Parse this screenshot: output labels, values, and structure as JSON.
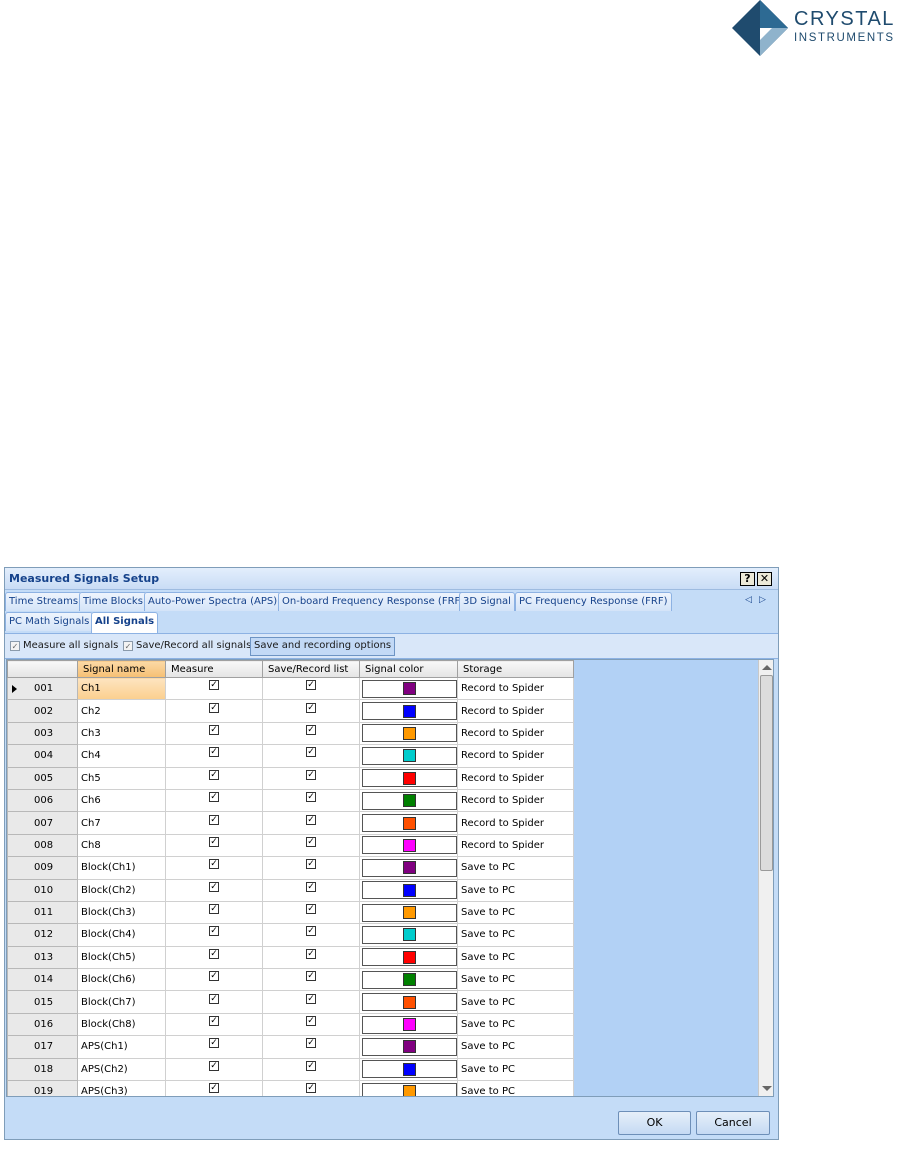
{
  "logo": {
    "word1": "CRYSTAL",
    "word2": "INSTRUMENTS"
  },
  "dialog": {
    "title": "Measured Signals Setup",
    "help_label": "?",
    "close_label": "✕",
    "tabs_row1": [
      "Time Streams",
      "Time Blocks",
      "Auto-Power Spectra (APS)",
      "On-board Frequency Response (FRF)",
      "3D Signal",
      "PC Frequency Response (FRF)"
    ],
    "tabs_row2": [
      "PC Math Signals",
      "All Signals"
    ],
    "tab_scroll_left": "◁",
    "tab_scroll_right": "▷",
    "toolbar": {
      "measure_all": "Measure all signals",
      "save_record_all": "Save/Record all signals",
      "options_button": "Save and recording options"
    },
    "columns": [
      "Signal name",
      "Measure",
      "Save/Record list",
      "Signal color",
      "Storage"
    ],
    "rows": [
      {
        "id": "001",
        "name": "Ch1",
        "color": "#800080",
        "storage": "Record to Spider"
      },
      {
        "id": "002",
        "name": "Ch2",
        "color": "#0000ff",
        "storage": "Record to Spider"
      },
      {
        "id": "003",
        "name": "Ch3",
        "color": "#ff9900",
        "storage": "Record to Spider"
      },
      {
        "id": "004",
        "name": "Ch4",
        "color": "#00cccc",
        "storage": "Record to Spider"
      },
      {
        "id": "005",
        "name": "Ch5",
        "color": "#ff0000",
        "storage": "Record to Spider"
      },
      {
        "id": "006",
        "name": "Ch6",
        "color": "#008000",
        "storage": "Record to Spider"
      },
      {
        "id": "007",
        "name": "Ch7",
        "color": "#ff5000",
        "storage": "Record to Spider"
      },
      {
        "id": "008",
        "name": "Ch8",
        "color": "#ff00ff",
        "storage": "Record to Spider"
      },
      {
        "id": "009",
        "name": "Block(Ch1)",
        "color": "#800080",
        "storage": "Save to PC"
      },
      {
        "id": "010",
        "name": "Block(Ch2)",
        "color": "#0000ff",
        "storage": "Save to PC"
      },
      {
        "id": "011",
        "name": "Block(Ch3)",
        "color": "#ff9900",
        "storage": "Save to PC"
      },
      {
        "id": "012",
        "name": "Block(Ch4)",
        "color": "#00cccc",
        "storage": "Save to PC"
      },
      {
        "id": "013",
        "name": "Block(Ch5)",
        "color": "#ff0000",
        "storage": "Save to PC"
      },
      {
        "id": "014",
        "name": "Block(Ch6)",
        "color": "#008000",
        "storage": "Save to PC"
      },
      {
        "id": "015",
        "name": "Block(Ch7)",
        "color": "#ff5000",
        "storage": "Save to PC"
      },
      {
        "id": "016",
        "name": "Block(Ch8)",
        "color": "#ff00ff",
        "storage": "Save to PC"
      },
      {
        "id": "017",
        "name": "APS(Ch1)",
        "color": "#800080",
        "storage": "Save to PC"
      },
      {
        "id": "018",
        "name": "APS(Ch2)",
        "color": "#0000ff",
        "storage": "Save to PC"
      },
      {
        "id": "019",
        "name": "APS(Ch3)",
        "color": "#ff9900",
        "storage": "Save to PC"
      }
    ],
    "check_glyph": "✓",
    "ok_label": "OK",
    "cancel_label": "Cancel"
  }
}
